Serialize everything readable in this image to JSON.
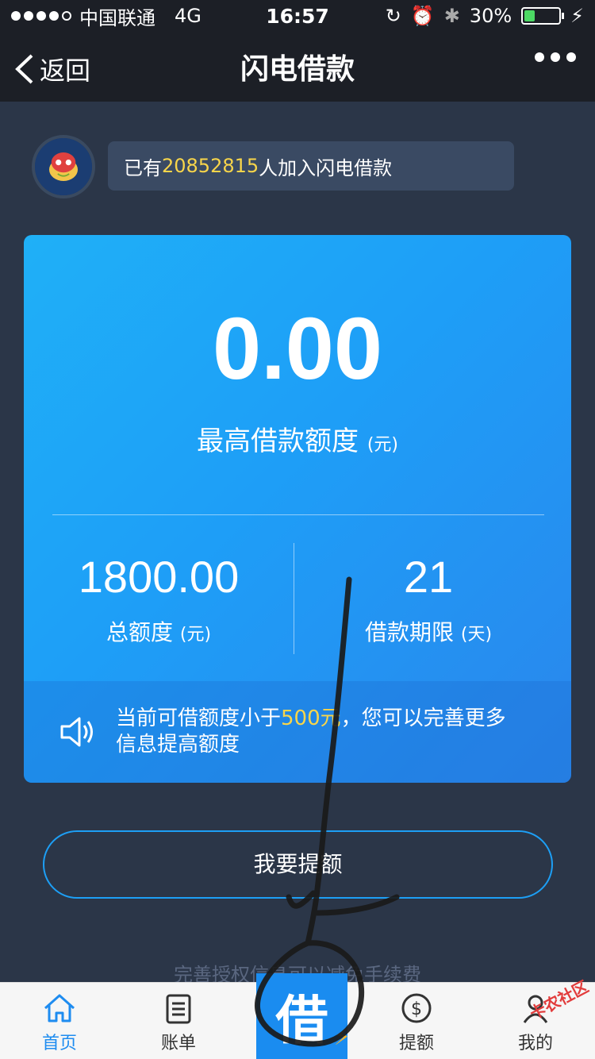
{
  "status_bar": {
    "carrier": "中国联通",
    "network": "4G",
    "time": "16:57",
    "battery": "30%",
    "battery_level": 0.3
  },
  "nav": {
    "back_label": "返回",
    "title": "闪电借款"
  },
  "join": {
    "prefix": "已有",
    "count": "20852815",
    "suffix": "人加入闪电借款"
  },
  "card": {
    "amount": "0.00",
    "amount_label": "最高借款额度",
    "amount_unit": "(元)",
    "total_value": "1800.00",
    "total_label": "总额度",
    "total_unit": "(元)",
    "term_value": "21",
    "term_label": "借款期限",
    "term_unit": "(天)",
    "notice_prefix": "当前可借额度小于",
    "notice_highlight": "500元",
    "notice_suffix": "，您可以完善更多信息提高额度"
  },
  "actions": {
    "raise_label": "我要提额",
    "hint": "完善授权信息可以减免手续费"
  },
  "tabs": [
    {
      "label": "首页"
    },
    {
      "label": "账单"
    },
    {
      "label": "借"
    },
    {
      "label": "提额"
    },
    {
      "label": "我的"
    }
  ],
  "watermark": "卡农社区",
  "colors": {
    "accent": "#1e8cf0",
    "highlight": "#f8d54a",
    "background": "#2b3648"
  }
}
